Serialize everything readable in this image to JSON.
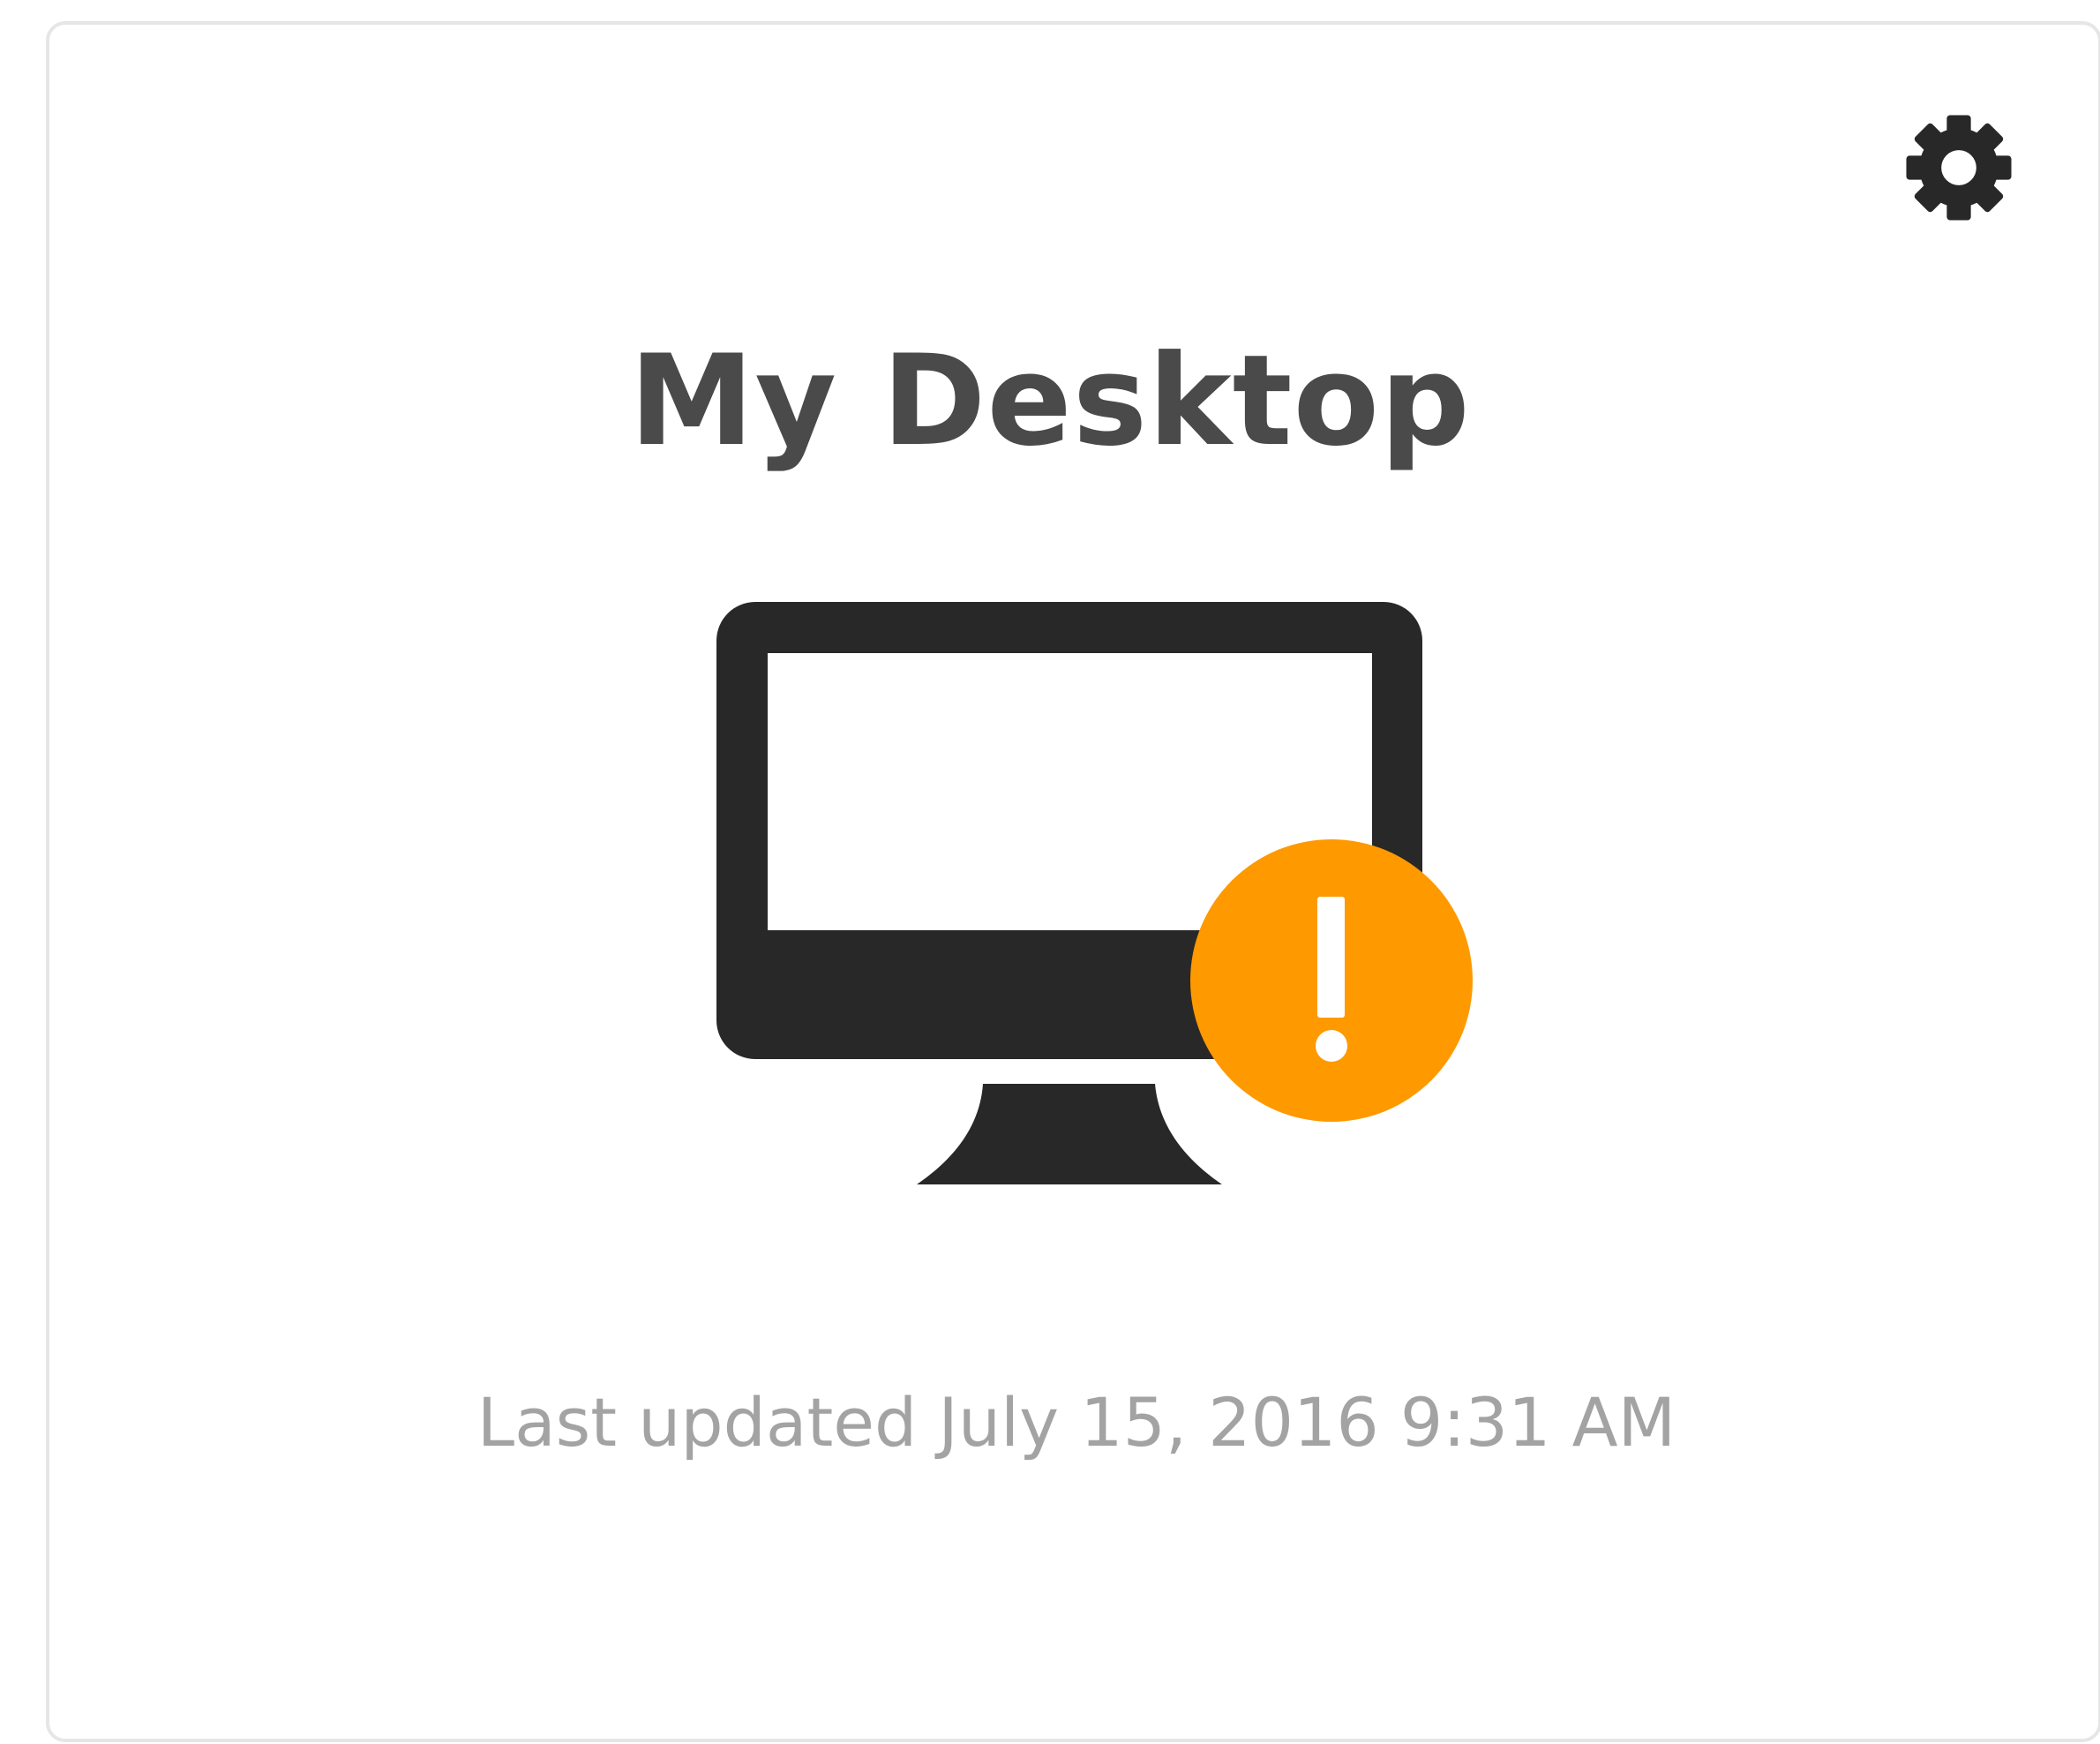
{
  "card": {
    "title": "My Desktop",
    "last_updated": "Last updated July 15, 2016 9:31 AM",
    "status": "warning"
  },
  "icons": {
    "settings": "gear-icon",
    "device": "desktop-monitor-icon",
    "status": "warning-exclamation-icon"
  },
  "colors": {
    "title": "#4a4a4a",
    "icon_dark": "#282828",
    "warning": "#ff9900",
    "muted_text": "#a3a3a3",
    "border": "#e6e6e6"
  }
}
